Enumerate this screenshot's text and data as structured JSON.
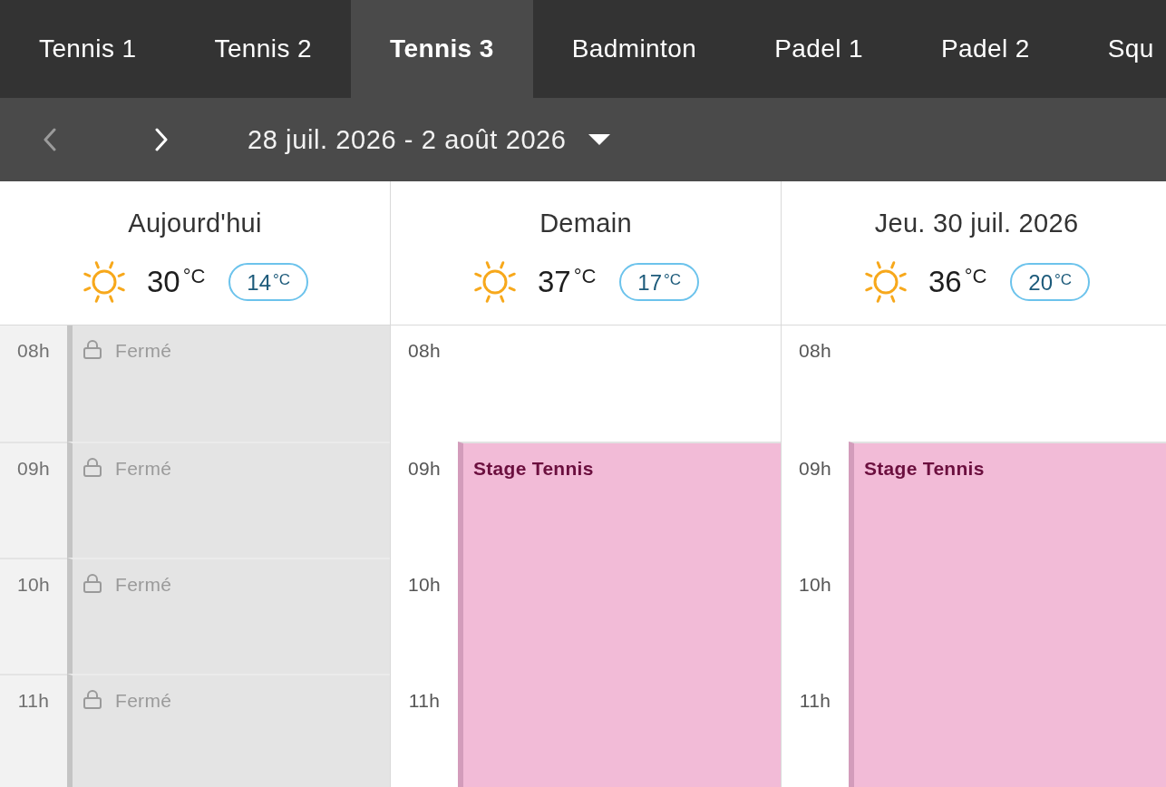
{
  "tabs": [
    {
      "label": "Tennis 1",
      "selected": false
    },
    {
      "label": "Tennis 2",
      "selected": false
    },
    {
      "label": "Tennis 3",
      "selected": true
    },
    {
      "label": "Badminton",
      "selected": false
    },
    {
      "label": "Padel 1",
      "selected": false
    },
    {
      "label": "Padel 2",
      "selected": false
    },
    {
      "label": "Squ",
      "selected": false
    }
  ],
  "date_nav": {
    "previous": {
      "disabled": true
    },
    "next": {
      "disabled": false
    },
    "range": "28 juil. 2026 - 2 août 2026"
  },
  "days": [
    {
      "title": "Aujourd'hui",
      "weather": {
        "high": "30",
        "high_unit": "°C",
        "low": "14",
        "low_unit": "°C"
      },
      "slots": [
        {
          "time": "08h",
          "kind": "closed",
          "label": "Fermé"
        },
        {
          "time": "09h",
          "kind": "closed",
          "label": "Fermé"
        },
        {
          "time": "10h",
          "kind": "closed",
          "label": "Fermé"
        },
        {
          "time": "11h",
          "kind": "closed",
          "label": "Fermé"
        }
      ]
    },
    {
      "title": "Demain",
      "weather": {
        "high": "37",
        "high_unit": "°C",
        "low": "17",
        "low_unit": "°C"
      },
      "slots": [
        {
          "time": "08h",
          "kind": "free"
        },
        {
          "time": "09h",
          "kind": "event",
          "title": "Stage Tennis"
        },
        {
          "time": "10h",
          "kind": "continued"
        },
        {
          "time": "11h",
          "kind": "continued"
        }
      ]
    },
    {
      "title": "Jeu. 30 juil. 2026",
      "weather": {
        "high": "36",
        "high_unit": "°C",
        "low": "20",
        "low_unit": "°C"
      },
      "slots": [
        {
          "time": "08h",
          "kind": "free"
        },
        {
          "time": "09h",
          "kind": "event",
          "title": "Stage Tennis"
        },
        {
          "time": "10h",
          "kind": "continued"
        },
        {
          "time": "11h",
          "kind": "continued"
        }
      ]
    }
  ]
}
